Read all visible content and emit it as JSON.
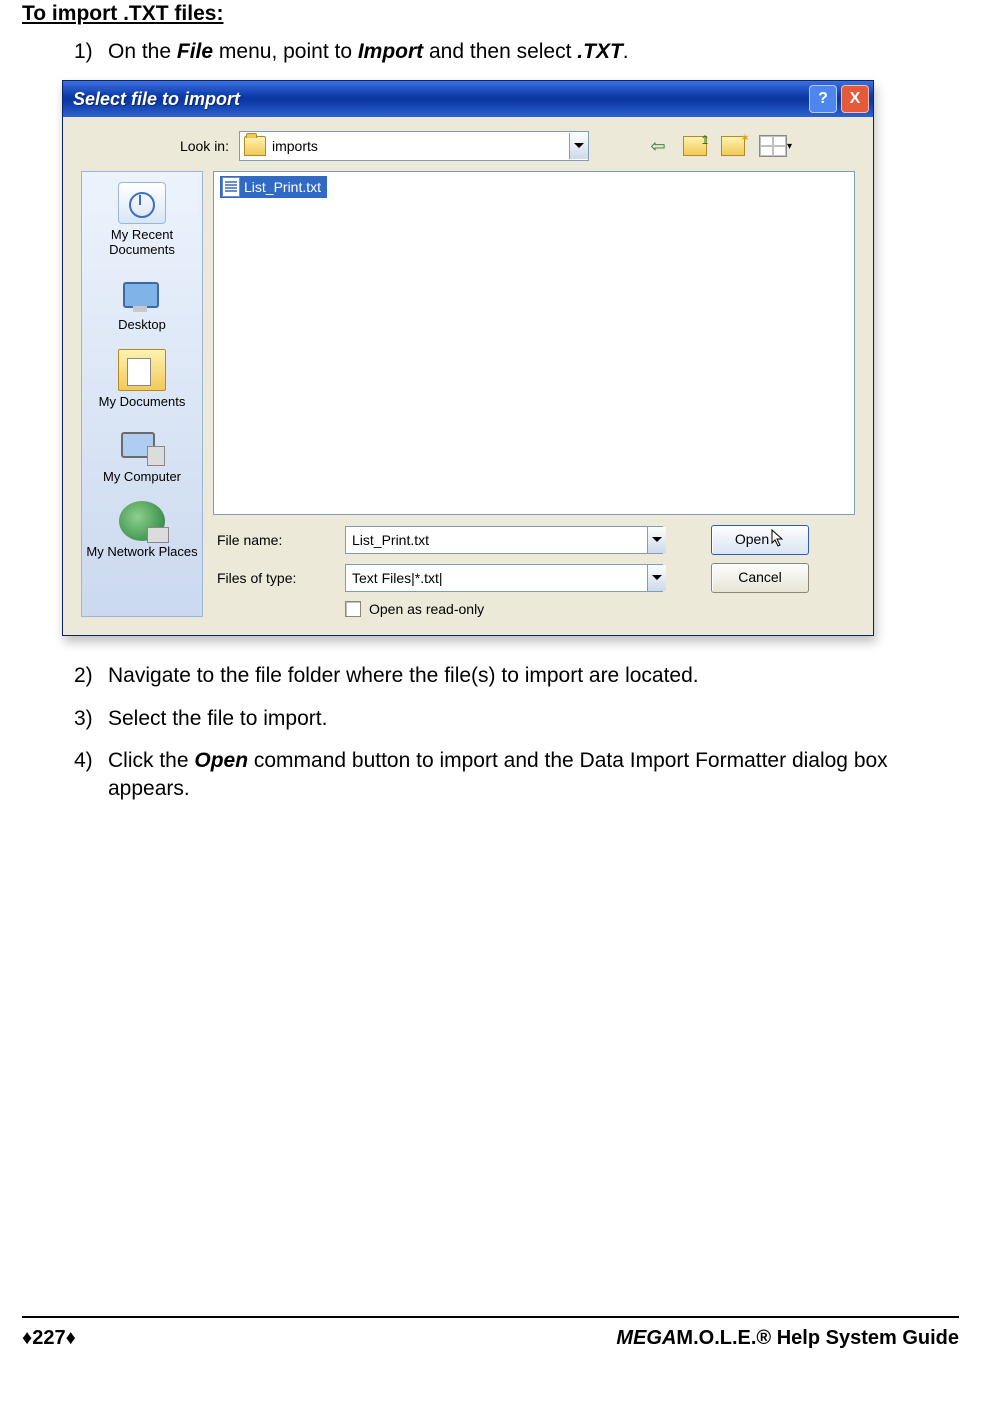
{
  "doc": {
    "heading": "To import .TXT files:",
    "step1_num": "1)",
    "step1_a": "On the ",
    "step1_b": "File",
    "step1_c": " menu, point to ",
    "step1_d": "Import",
    "step1_e": " and then select ",
    "step1_f": ".TXT",
    "step1_g": ".",
    "step2_num": "2)",
    "step2": "Navigate to the file folder where the file(s) to import are located.",
    "step3_num": "3)",
    "step3": "Select the file to import.",
    "step4_num": "4)",
    "step4_a": "Click the ",
    "step4_b": "Open",
    "step4_c": " command button to import and the Data Import Formatter dialog box appears."
  },
  "dialog": {
    "title": "Select file to import",
    "help": "?",
    "close": "X",
    "lookin_label": "Look in:",
    "lookin_value": "imports",
    "places": {
      "recent": "My Recent Documents",
      "desktop": "Desktop",
      "docs": "My Documents",
      "computer": "My Computer",
      "network": "My Network Places"
    },
    "listing_file": "List_Print.txt",
    "filename_label": "File name:",
    "filename_value": "List_Print.txt",
    "filetype_label": "Files of type:",
    "filetype_value": "Text Files|*.txt|",
    "readonly_label": "Open as read-only",
    "open_btn": "Open",
    "cancel_btn": "Cancel"
  },
  "footer": {
    "page": "♦227♦",
    "mega": "MEGA",
    "rest": "M.O.L.E.® Help System Guide"
  }
}
